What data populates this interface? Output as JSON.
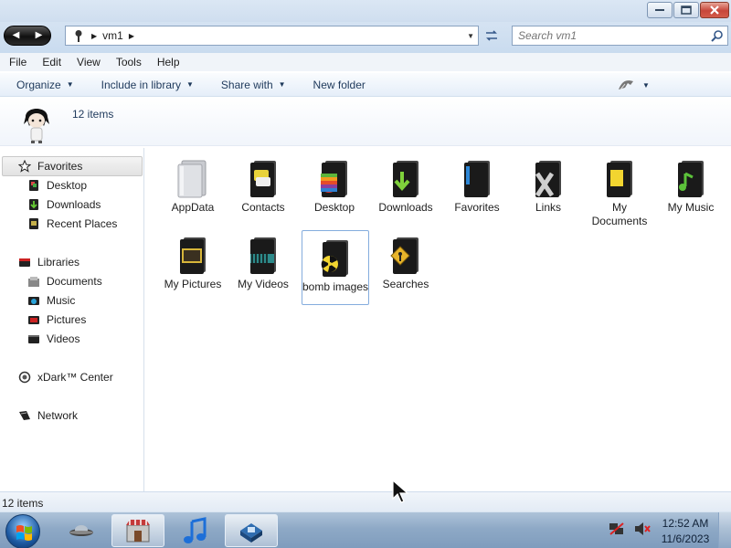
{
  "window": {
    "buttons": [
      {
        "name": "minimize",
        "icon": "minimize-icon"
      },
      {
        "name": "maximize",
        "icon": "maximize-icon"
      },
      {
        "name": "close",
        "icon": "close-icon"
      }
    ]
  },
  "address": {
    "crumbs": [
      "vm1"
    ],
    "search_placeholder": "Search vm1"
  },
  "menu": {
    "items": [
      "File",
      "Edit",
      "View",
      "Tools",
      "Help"
    ]
  },
  "toolbar": {
    "organize": "Organize",
    "include_in_library": "Include in library",
    "share_with": "Share with",
    "new_folder": "New folder"
  },
  "details": {
    "item_count": "12 items"
  },
  "nav": {
    "favorites": {
      "label": "Favorites",
      "items": [
        "Desktop",
        "Downloads",
        "Recent Places"
      ]
    },
    "libraries": {
      "label": "Libraries",
      "items": [
        "Documents",
        "Music",
        "Pictures",
        "Videos"
      ]
    },
    "xdark": "xDark™ Center",
    "network": "Network"
  },
  "files": [
    {
      "label": "AppData",
      "icon": "folder-plain-icon"
    },
    {
      "label": "Contacts",
      "icon": "folder-contacts-icon"
    },
    {
      "label": "Desktop",
      "icon": "folder-desktop-icon"
    },
    {
      "label": "Downloads",
      "icon": "folder-downloads-icon"
    },
    {
      "label": "Favorites",
      "icon": "folder-favorites-icon"
    },
    {
      "label": "Links",
      "icon": "folder-links-icon"
    },
    {
      "label": "My Documents",
      "icon": "folder-documents-icon"
    },
    {
      "label": "My Music",
      "icon": "folder-music-icon"
    },
    {
      "label": "My Pictures",
      "icon": "folder-pictures-icon"
    },
    {
      "label": "My Videos",
      "icon": "folder-videos-icon"
    },
    {
      "label": "bomb images",
      "icon": "folder-bomb-icon",
      "selected": true
    },
    {
      "label": "Searches",
      "icon": "folder-searches-icon"
    }
  ],
  "status": {
    "text": "12 items"
  },
  "taskbar": {
    "apps": [
      "ufo-app-icon",
      "store-app-icon",
      "music-app-icon",
      "explorer-app-icon"
    ],
    "active_app": "explorer-app-icon",
    "tray": [
      "network-icon",
      "volume-muted-icon"
    ],
    "time": "12:52 AM",
    "date": "11/6/2023"
  },
  "colors": {
    "accent": "#1e395b",
    "selection_border": "#84acdd",
    "taskbar": "#8ea9c6"
  }
}
